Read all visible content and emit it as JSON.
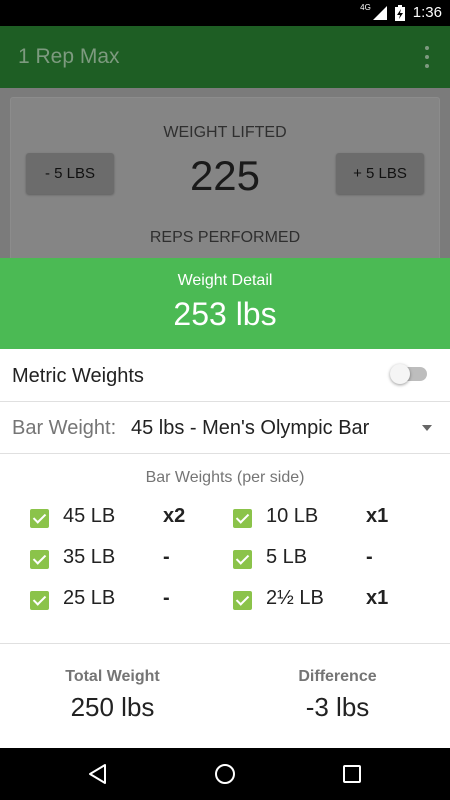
{
  "status_bar": {
    "network": "4G",
    "time": "1:36"
  },
  "app_bar": {
    "title": "1 Rep Max"
  },
  "background": {
    "weight_label": "WEIGHT LIFTED",
    "weight_value": "225",
    "minus_button": "- 5 LBS",
    "plus_button": "+ 5 LBS",
    "reps_label": "REPS PERFORMED"
  },
  "detail": {
    "header_label": "Weight Detail",
    "header_value": "253 lbs",
    "metric_label": "Metric Weights",
    "metric_on": false,
    "bar_label": "Bar Weight:",
    "bar_value": "45 lbs - Men's Olympic Bar",
    "plates_title": "Bar Weights (per side)",
    "plates": [
      {
        "weight": "45 LB",
        "count": "x2",
        "checked": true
      },
      {
        "weight": "10 LB",
        "count": "x1",
        "checked": true
      },
      {
        "weight": "35 LB",
        "count": "-",
        "checked": true
      },
      {
        "weight": "5 LB",
        "count": "-",
        "checked": true
      },
      {
        "weight": "25 LB",
        "count": "-",
        "checked": true
      },
      {
        "weight": "2½ LB",
        "count": "x1",
        "checked": true
      }
    ],
    "total_label": "Total Weight",
    "total_value": "250 lbs",
    "difference_label": "Difference",
    "difference_value": "-3 lbs"
  },
  "colors": {
    "header_green": "#4bba54",
    "checkbox_green": "#8bc34a",
    "app_bar": "#1e5e24"
  }
}
